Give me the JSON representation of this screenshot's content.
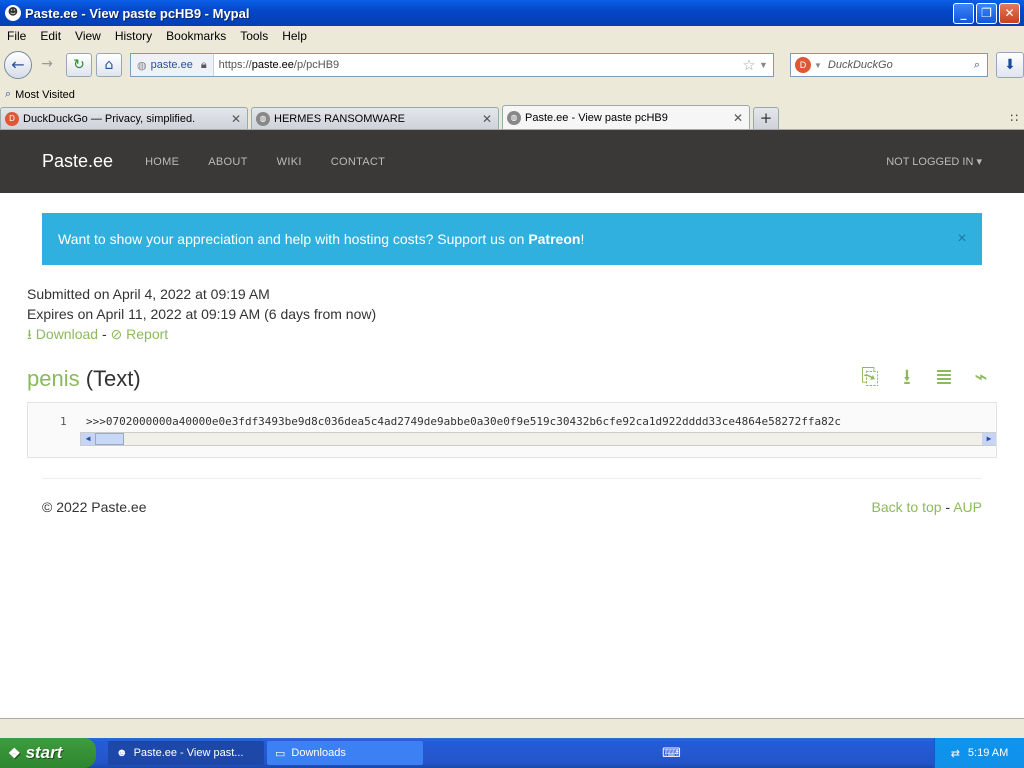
{
  "window": {
    "title": "Paste.ee - View paste pcHB9 - Mypal",
    "min": "_",
    "max": "❐",
    "close": "✕"
  },
  "menu": [
    "File",
    "Edit",
    "View",
    "History",
    "Bookmarks",
    "Tools",
    "Help"
  ],
  "nav": {
    "identity": "paste.ee",
    "url_prefix": "https://",
    "url_domain": "paste.ee",
    "url_path": "/p/pcHB9",
    "search_placeholder": "DuckDuckGo"
  },
  "bookmarks": {
    "most_visited": "Most Visited"
  },
  "tabs": [
    {
      "label": "DuckDuckGo — Privacy, simplified.",
      "icon_color": "#de5833"
    },
    {
      "label": "HERMES RANSOMWARE",
      "icon_color": "#888888"
    },
    {
      "label": "Paste.ee - View paste pcHB9",
      "icon_color": "#888888"
    }
  ],
  "site": {
    "brand": "Paste.ee",
    "nav": [
      "HOME",
      "ABOUT",
      "WIKI",
      "CONTACT"
    ],
    "login": "NOT LOGGED IN ▾",
    "alert": {
      "text": "Want to show your appreciation and help with hosting costs? Support us on ",
      "link": "Patreon",
      "tail": "!",
      "close": "×"
    },
    "submitted": "Submitted on April 4, 2022 at 09:19 AM",
    "expires": "Expires on April 11, 2022 at 09:19 AM (6 days from now)",
    "download": "Download",
    "separator": " - ",
    "report": "Report",
    "paste_name": "penis",
    "paste_type": "(Text)",
    "code": {
      "line": "1",
      "text": ">>>0702000000a40000e0e3fdf3493be9d8c036dea5c4ad2749de9abbe0a30e0f9e519c30432b6cfe92ca1d922dddd33ce4864e58272ffa82c"
    },
    "footer": {
      "copyright": "© 2022 Paste.ee",
      "back_to_top": "Back to top",
      "sep": " - ",
      "aup": "AUP"
    },
    "accent": "#8cba5a",
    "alert_color": "#2fb0de"
  },
  "taskbar": {
    "start": "start",
    "tasks": [
      "Paste.ee - View past...",
      "Downloads"
    ],
    "clock": "5:19 AM"
  }
}
